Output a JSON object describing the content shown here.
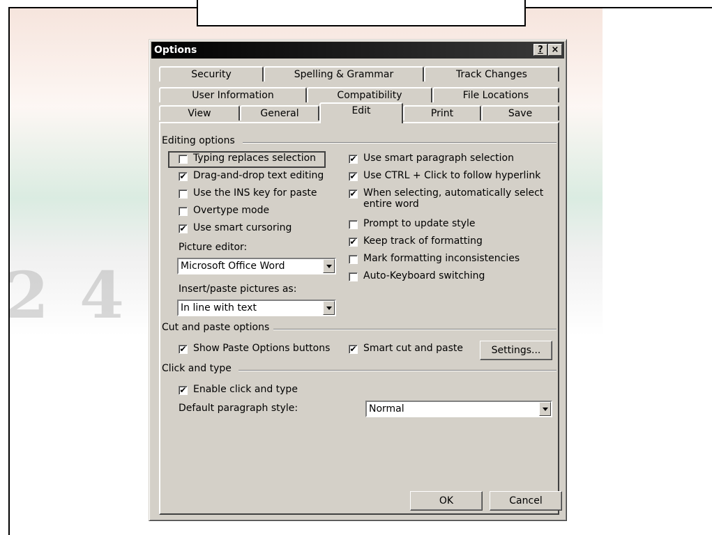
{
  "dialog": {
    "title": "Options",
    "help_glyph": "?",
    "close_glyph": "×"
  },
  "tabs": {
    "row1": [
      "Security",
      "Spelling & Grammar",
      "Track Changes"
    ],
    "row2": [
      "User Information",
      "Compatibility",
      "File Locations"
    ],
    "row3": [
      "View",
      "General",
      "Edit",
      "Print",
      "Save"
    ],
    "active": "Edit"
  },
  "editing": {
    "group_label": "Editing options",
    "typing_replaces": {
      "label": "Typing replaces selection",
      "checked": false
    },
    "drag_drop": {
      "label": "Drag-and-drop text editing",
      "checked": true
    },
    "ins_key": {
      "label": "Use the INS key for paste",
      "checked": false
    },
    "overtype": {
      "label": "Overtype mode",
      "checked": false
    },
    "smart_cursoring": {
      "label": "Use smart cursoring",
      "checked": true
    },
    "picture_editor_label": "Picture editor:",
    "picture_editor_value": "Microsoft Office Word",
    "insert_paste_label": "Insert/paste pictures as:",
    "insert_paste_value": "In line with text",
    "smart_paragraph": {
      "label": "Use smart paragraph selection",
      "checked": true
    },
    "ctrl_click": {
      "label": "Use CTRL + Click to follow hyperlink",
      "checked": true
    },
    "auto_select_word": {
      "label_line1": "When selecting, automatically select",
      "label_line2": "entire word",
      "checked": true
    },
    "prompt_update_style": {
      "label": "Prompt to update style",
      "checked": false
    },
    "keep_track_formatting": {
      "label": "Keep track of formatting",
      "checked": true
    },
    "mark_inconsistencies": {
      "label": "Mark formatting inconsistencies",
      "checked": false
    },
    "auto_keyboard": {
      "label": "Auto-Keyboard switching",
      "checked": false
    }
  },
  "cut_paste": {
    "group_label": "Cut and paste options",
    "show_paste_options": {
      "label": "Show Paste Options buttons",
      "checked": true
    },
    "smart_cut_paste": {
      "label": "Smart cut and paste",
      "checked": true
    },
    "settings_button": "Settings..."
  },
  "click_type": {
    "group_label": "Click and type",
    "enable": {
      "label": "Enable click and type",
      "checked": true
    },
    "default_style_label": "Default paragraph style:",
    "default_style_value": "Normal"
  },
  "footer": {
    "ok": "OK",
    "cancel": "Cancel"
  },
  "check_glyph": "✔"
}
